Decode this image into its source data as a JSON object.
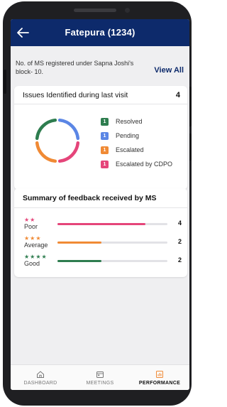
{
  "header": {
    "title": "Fatepura (1234)",
    "back_icon": "arrow-left-icon"
  },
  "info": {
    "text": "No. of MS registered under Sapna Joshi's block- 10.",
    "view_all_label": "View All"
  },
  "issues": {
    "title": "Issues Identified during last visit",
    "count": "4",
    "legend": [
      {
        "count": "1",
        "label": "Resolved",
        "color": "#2e7d4f"
      },
      {
        "count": "1",
        "label": "Pending",
        "color": "#5b86e5"
      },
      {
        "count": "1",
        "label": "Escalated",
        "color": "#f08a35"
      },
      {
        "count": "1",
        "label": "Escalated by CDPO",
        "color": "#e5457a"
      }
    ]
  },
  "feedback": {
    "title": "Summary of feedback received by MS",
    "max": 5,
    "rows": [
      {
        "stars": "★★",
        "label": "Poor",
        "count": "4",
        "value": 4,
        "color": "#e5457a",
        "star_color": "#e5457a"
      },
      {
        "stars": "★★★",
        "label": "Average",
        "count": "2",
        "value": 2,
        "color": "#f08a35",
        "star_color": "#f08a35"
      },
      {
        "stars": "★★★★",
        "label": "Good",
        "count": "2",
        "value": 2,
        "color": "#2e7d4f",
        "star_color": "#2e7d4f"
      }
    ]
  },
  "bottom_nav": [
    {
      "label": "DASHBOARD",
      "icon": "home-icon"
    },
    {
      "label": "MEETINGS",
      "icon": "calendar-icon"
    },
    {
      "label": "PERFORMANCE",
      "icon": "chart-icon",
      "active": true
    }
  ]
}
